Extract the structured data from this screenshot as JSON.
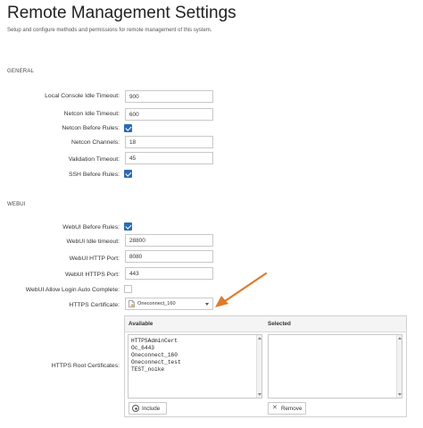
{
  "page": {
    "title": "Remote Management Settings",
    "subtitle": "Setup and configure methods and permissions for remote management of this system."
  },
  "general": {
    "heading": "GENERAL",
    "local_console_idle_timeout": {
      "label": "Local Console Idle Timeout:",
      "value": "900"
    },
    "netcon_idle_timeout": {
      "label": "Netcon Idle Timeout:",
      "value": "600"
    },
    "netcon_before_rules": {
      "label": "Netcon Before Rules:",
      "checked": true
    },
    "netcon_channels": {
      "label": "Netcon Channels:",
      "value": "18"
    },
    "validation_timeout": {
      "label": "Validation Timeout:",
      "value": "45"
    },
    "ssh_before_rules": {
      "label": "SSH Before Rules:",
      "checked": true
    }
  },
  "webui": {
    "heading": "WEBUI",
    "webui_before_rules": {
      "label": "WebUI Before Rules:",
      "checked": true
    },
    "webui_idle_timeout": {
      "label": "WebUI Idle timeout:",
      "value": "28800"
    },
    "webui_http_port": {
      "label": "WebUI HTTP Port:",
      "value": "8080"
    },
    "webui_https_port": {
      "label": "WebUI HTTPS Port:",
      "value": "443"
    },
    "allow_login_auto_complete": {
      "label": "WebUI Allow Login Auto Complete:",
      "checked": false
    },
    "https_certificate": {
      "label": "HTTPS Certificate:",
      "selected": "Oneconnect_160",
      "icon": "document-icon"
    },
    "https_root_certificates": {
      "label": "HTTPS Root Certificates:",
      "available_header": "Available",
      "selected_header": "Selected",
      "available": [
        "HTTPSAdminCert",
        "Oc_6443",
        "Oneconnect_160",
        "Oneconnect_test",
        "TEST_noike"
      ],
      "selected": [],
      "include_label": "Include",
      "remove_label": "Remove"
    }
  },
  "annotation": {
    "arrow_color": "#e07b2a",
    "icon": "arrow-icon"
  },
  "colors": {
    "accent": "#2b6cb0",
    "panel_header": "#f4f4f4",
    "border": "#c8c8c8"
  }
}
